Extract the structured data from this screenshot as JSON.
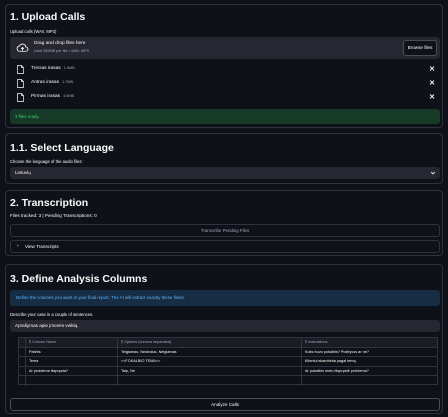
{
  "upload": {
    "title": "1. Upload Calls",
    "label": "Upload calls (WAV, MP3)",
    "drop_title": "Drag and drop files here",
    "drop_limit": "Limit 200MB per file • WAV, MP3",
    "browse_label": "Browse files",
    "files": [
      {
        "name": "Trecias irasas",
        "size": "1.6MB"
      },
      {
        "name": "Antras irasas",
        "size": "1.7MB"
      },
      {
        "name": "Pirmas irasas",
        "size": "4.9MB"
      }
    ],
    "success_message": "3 files ready."
  },
  "language": {
    "title": "1.1. Select Language",
    "label": "Choose the language of the audio files:",
    "selected": "Lietuvių"
  },
  "transcription": {
    "title": "2. Transcription",
    "status": "Files tracked: 3 | Pending Transcriptions: 0",
    "transcribe_label": "Transcribe Pending Files",
    "expander_label": "View Transcripts"
  },
  "analysis": {
    "title": "3. Define Analysis Columns",
    "info": "Define the columns you want in your final report. The AI will extract exactly these fields.",
    "case_label": "Describe your case in a couple of sentences.",
    "case_value": "Aprašymas apie įmonės veiklą.",
    "table": {
      "headers": [
        "Column Name",
        "Options (comma separated)",
        "Instructions"
      ],
      "rows": [
        [
          "Patirtis",
          "Teigiamas, Neutralus, Neigiamas",
          "Koks buvo pokalbis? Pozityvus ar ne?"
        ],
        [
          "Tema",
          "<<FOKALBIO TEMA>>",
          "Klientui skambinta pagal temą"
        ],
        [
          "Ar problema išspręsta?",
          "Taip, Ne",
          "Ar pokalbio metu išspręstė problema?"
        ],
        [
          "",
          "",
          ""
        ]
      ]
    },
    "analyze_label": "Analyze Calls"
  },
  "colors": {
    "background": "#0e1117",
    "input_bg": "#262730",
    "success_bg": "#173928",
    "success_text": "#3dd56d",
    "info_bg": "#172d43",
    "info_text": "#60b4ff"
  },
  "icons": [
    "cloud-upload-icon",
    "file-icon",
    "close-icon",
    "chevron-down-icon",
    "chevron-right-icon",
    "text-column-icon"
  ]
}
